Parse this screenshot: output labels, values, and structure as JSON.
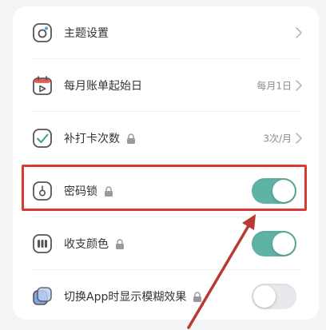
{
  "settings": {
    "items": [
      {
        "label": "主题设置",
        "value": "",
        "control": "chevron",
        "icon": "theme-icon",
        "locked": false
      },
      {
        "label": "每月账单起始日",
        "value": "每月1日",
        "control": "chevron",
        "icon": "calendar-icon",
        "locked": false
      },
      {
        "label": "补打卡次数",
        "value": "3次/月",
        "control": "chevron",
        "icon": "check-in-icon",
        "locked": true
      },
      {
        "label": "密码锁",
        "value": "",
        "control": "toggle",
        "state": "on",
        "icon": "password-lock-icon",
        "locked": true
      },
      {
        "label": "收支颜色",
        "value": "",
        "control": "toggle",
        "state": "on",
        "icon": "color-icon",
        "locked": true
      },
      {
        "label": "切换App时显示模糊效果",
        "value": "",
        "control": "toggle",
        "state": "off",
        "icon": "blur-effect-icon",
        "locked": true
      }
    ]
  },
  "colors": {
    "accent": "#5fb3a5",
    "toggle_off": "#e8e9ec",
    "annotation_red": "#d73b33",
    "text": "#333333",
    "subtext": "#8a8a8a"
  },
  "annotation": {
    "highlighted_item": "密码锁",
    "arrow": "pointing-up-right-to-toggle"
  }
}
